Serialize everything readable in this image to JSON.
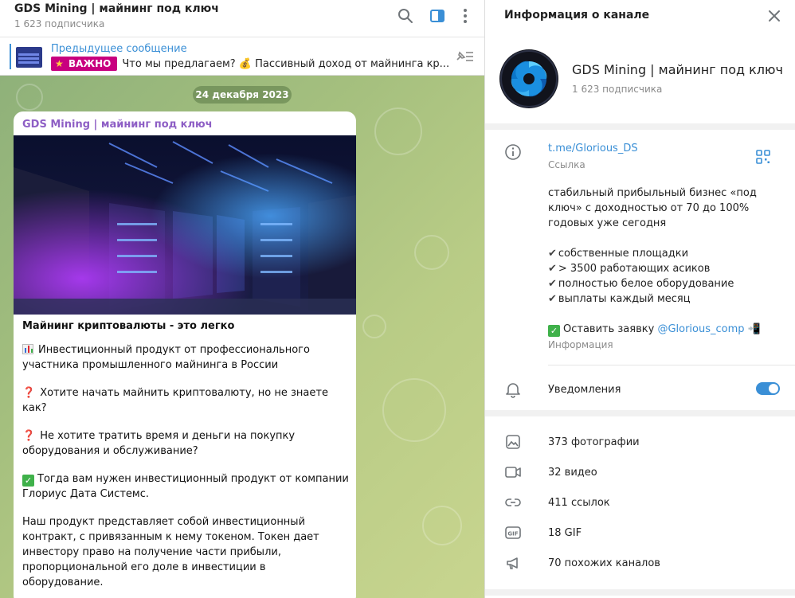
{
  "chat": {
    "title": "GDS Mining | майнинг под ключ",
    "subscribers": "1 623 подписчика",
    "pinned": {
      "label": "Предыдущее сообщение",
      "badge": "ВАЖНО",
      "text": "Что мы предлагаем? 💰 Пассивный доход от майнинга кр..."
    },
    "date_chip": "24 декабря 2023",
    "message": {
      "author": "GDS Mining | майнинг под ключ",
      "heading": "Майнинг криптовалюты - это легко",
      "p1": "Инвестиционный продукт от профессионального участника промышленного майнинга в России",
      "p2": "Хотите начать майнить криптовалюту, но не знаете как?",
      "p3": "Не хотите тратить время и деньги на покупку оборудования и обслуживание?",
      "p4": "Тогда вам нужен инвестиционный продукт от компании Глориус Дата Системс.",
      "p5": " Наш продукт представляет собой инвестиционный контракт, с привязанным к нему токеном. Токен дает инвестору право на получение части прибыли, пропорциональной его доле в инвестиции в оборудование."
    }
  },
  "info": {
    "title": "Информация о канале",
    "channel_name": "GDS Mining | майнинг под ключ",
    "subscribers": "1 623 подписчика",
    "link": "t.me/Glorious_DS",
    "link_caption": "Ссылка",
    "desc_1": "стабильный прибыльный бизнес «под ключ» с доходностью от 70 до 100% годовых уже сегодня",
    "bullet_1": "собственные площадки",
    "bullet_2": "> 3500 работающих асиков",
    "bullet_3": "полностью белое оборудование",
    "bullet_4": "выплаты каждый месяц",
    "apply_text": "Оставить заявку",
    "apply_mention": "@Glorious_comp",
    "desc_caption": "Информация",
    "notifications": "Уведомления",
    "media": {
      "photos": "373 фотографии",
      "videos": "32 видео",
      "links": "411 ссылок",
      "gifs": "18 GIF",
      "similar": "70 похожих каналов"
    }
  },
  "colors": {
    "accent": "#3a8fd6",
    "author": "#8e5fc5",
    "badge": "#c8007f"
  }
}
